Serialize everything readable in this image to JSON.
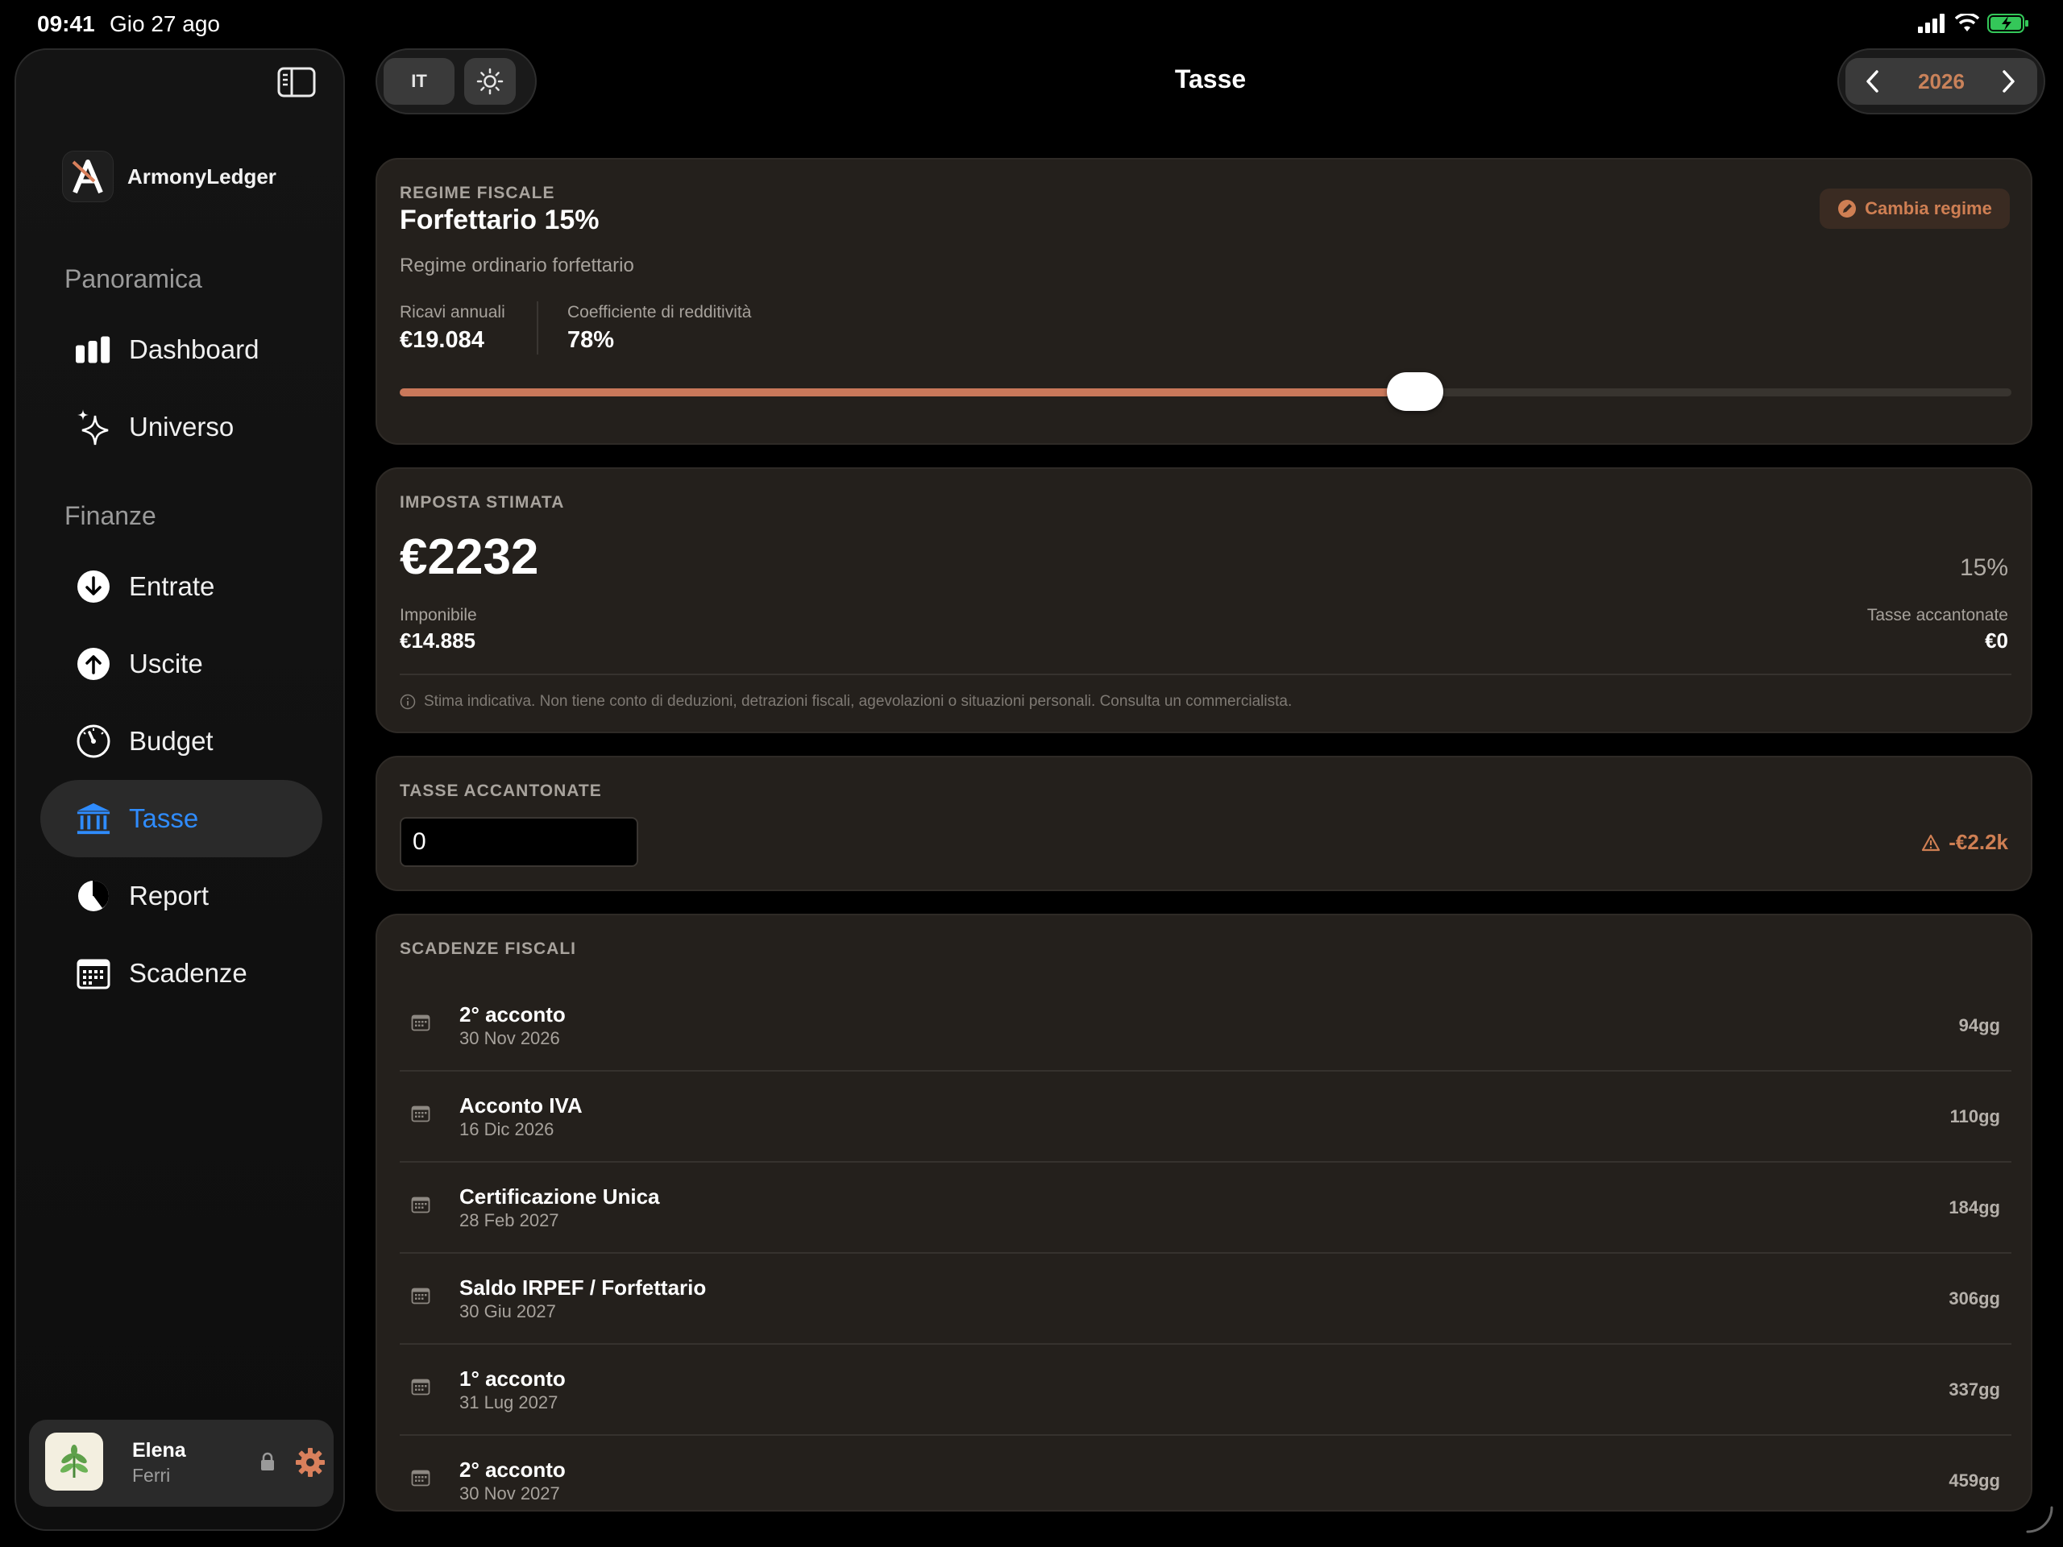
{
  "status": {
    "time": "09:41",
    "date": "Gio 27 ago"
  },
  "brand": {
    "name": "ArmonyLedger"
  },
  "nav": {
    "section_overview": "Panoramica",
    "section_finance": "Finanze",
    "items": [
      {
        "label": "Dashboard",
        "icon": "bar-chart-icon"
      },
      {
        "label": "Universo",
        "icon": "sparkles-icon"
      },
      {
        "label": "Entrate",
        "icon": "arrow-down-circle-icon"
      },
      {
        "label": "Uscite",
        "icon": "arrow-up-circle-icon"
      },
      {
        "label": "Budget",
        "icon": "gauge-icon"
      },
      {
        "label": "Tasse",
        "icon": "bank-icon",
        "active": true
      },
      {
        "label": "Report",
        "icon": "pie-chart-icon"
      },
      {
        "label": "Scadenze",
        "icon": "calendar-icon"
      }
    ]
  },
  "user": {
    "first": "Elena",
    "last": "Ferri"
  },
  "header": {
    "lang": "IT",
    "title": "Tasse",
    "year": "2026"
  },
  "regime": {
    "label": "REGIME FISCALE",
    "title": "Forfettario 15%",
    "subtitle": "Regime ordinario forfettario",
    "change_button": "Cambia regime",
    "revenue_label": "Ricavi annuali",
    "revenue_value": "€19.084",
    "coef_label": "Coefficiente di redditività",
    "coef_value": "78%",
    "slider_fraction": 0.63
  },
  "estimate": {
    "label": "IMPOSTA STIMATA",
    "amount": "€2232",
    "rate": "15%",
    "taxable_label": "Imponibile",
    "taxable_value": "€14.885",
    "saved_label": "Tasse accantonate",
    "saved_value": "€0",
    "disclaimer": "Stima indicativa. Non tiene conto di deduzioni, detrazioni fiscali, agevolazioni o situazioni personali. Consulta un commercialista."
  },
  "saved": {
    "label": "TASSE ACCANTONATE",
    "input_value": "0",
    "gap": "-€2.2k"
  },
  "deadlines": {
    "label": "SCADENZE FISCALI",
    "items": [
      {
        "name": "2° acconto",
        "date": "30 Nov 2026",
        "days": "94gg"
      },
      {
        "name": "Acconto IVA",
        "date": "16 Dic 2026",
        "days": "110gg"
      },
      {
        "name": "Certificazione Unica",
        "date": "28 Feb 2027",
        "days": "184gg"
      },
      {
        "name": "Saldo IRPEF / Forfettario",
        "date": "30 Giu 2027",
        "days": "306gg"
      },
      {
        "name": "1° acconto",
        "date": "31 Lug 2027",
        "days": "337gg"
      },
      {
        "name": "2° acconto",
        "date": "30 Nov 2027",
        "days": "459gg"
      }
    ]
  },
  "colors": {
    "accent": "#c9785a",
    "active_nav": "#2f8cff",
    "card_bg": "#24201c"
  }
}
